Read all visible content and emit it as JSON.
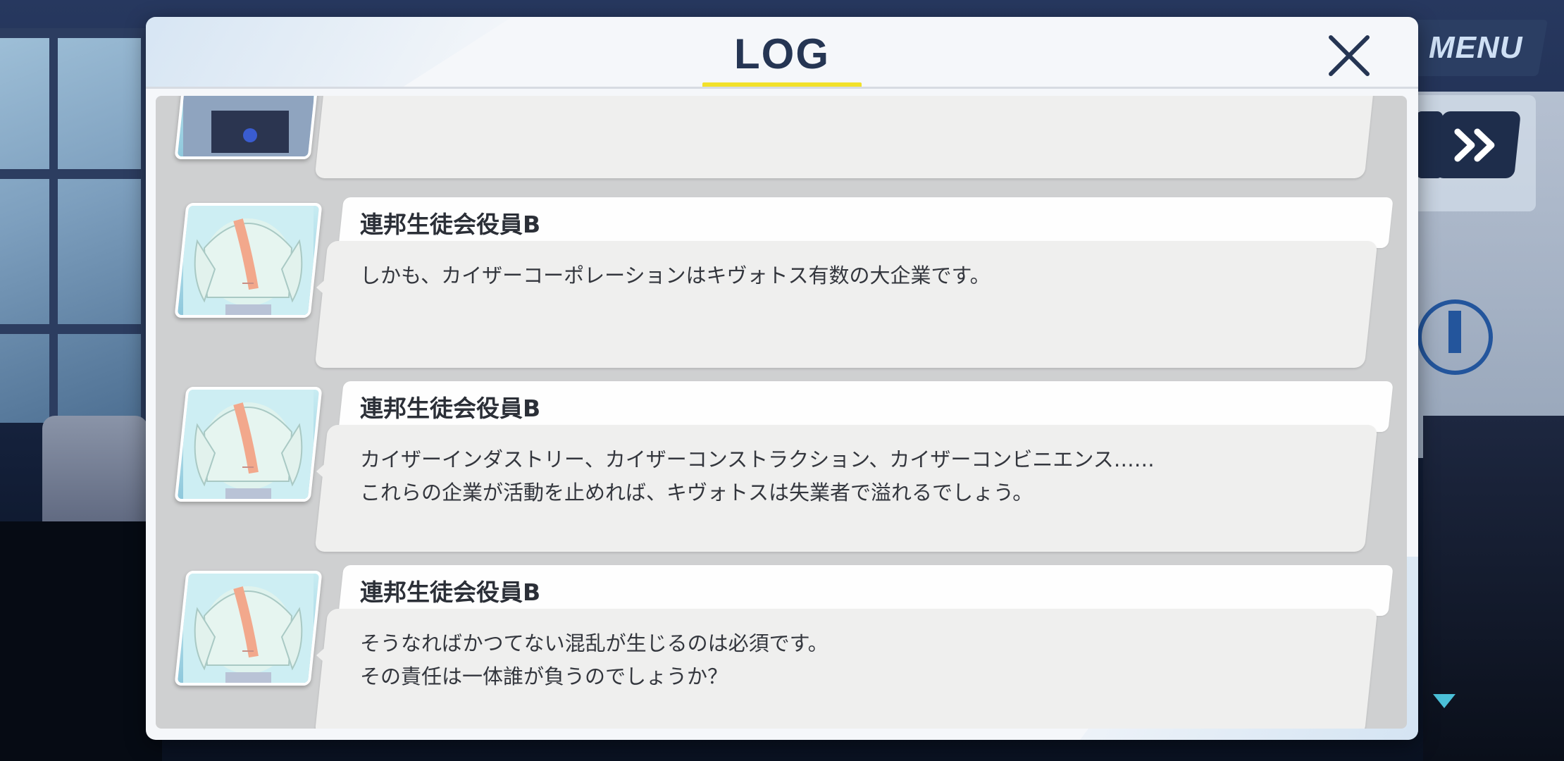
{
  "hud": {
    "menu_label": "MENU"
  },
  "dialog": {
    "title": "LOG"
  },
  "log_entries": [
    {
      "speaker": "連邦生徒会役員B",
      "text": "しかも、カイザーコーポレーションはキヴォトス有数の大企業です。"
    },
    {
      "speaker": "連邦生徒会役員B",
      "text": "カイザーインダストリー、カイザーコンストラクション、カイザーコンビニエンス……\nこれらの企業が活動を止めれば、キヴォトスは失業者で溢れるでしょう。"
    },
    {
      "speaker": "連邦生徒会役員B",
      "text": "そうなればかつてない混乱が生じるのは必須です。\nその責任は一体誰が負うのでしょうか？"
    }
  ],
  "colors": {
    "title_text": "#253553",
    "title_underline": "#f2e12a",
    "dialog_bg": "#f5f7fa",
    "list_bg": "#cfd0d1",
    "bubble_bg": "#efefee",
    "hud_button": "#1e2d4b",
    "scroll_indicator": "#4bc0d8"
  },
  "icons": {
    "close": "close-icon",
    "skip": "fast-forward-icon",
    "scroll_down": "triangle-down-icon"
  }
}
